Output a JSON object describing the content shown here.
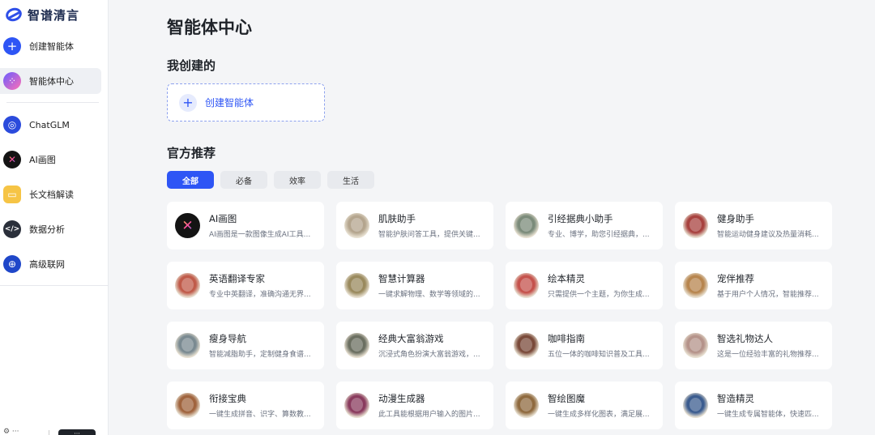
{
  "app": {
    "name": "智谱清言"
  },
  "sidebar": {
    "items": [
      {
        "label": "创建智能体",
        "icon": "plus-icon",
        "glyph": "+"
      },
      {
        "label": "智能体中心",
        "icon": "app-grid-icon",
        "glyph": "⁘"
      },
      {
        "label": "ChatGLM",
        "icon": "chatglm-logo-icon",
        "glyph": "◎"
      },
      {
        "label": "AI画图",
        "icon": "ai-draw-icon",
        "glyph": "✕"
      },
      {
        "label": "长文档解读",
        "icon": "folder-icon",
        "glyph": "▭"
      },
      {
        "label": "数据分析",
        "icon": "code-icon",
        "glyph": "</>"
      },
      {
        "label": "高级联网",
        "icon": "globe-icon",
        "glyph": "⊕"
      }
    ],
    "active_index": 1
  },
  "main": {
    "title": "智能体中心",
    "mine": {
      "heading": "我创建的",
      "create_label": "创建智能体"
    },
    "official": {
      "heading": "官方推荐",
      "tabs": [
        {
          "label": "全部",
          "active": true
        },
        {
          "label": "必备",
          "active": false
        },
        {
          "label": "效率",
          "active": false
        },
        {
          "label": "生活",
          "active": false
        }
      ],
      "cards": [
        {
          "title": "AI画图",
          "desc": "AI画图是一款图像生成AI工具...",
          "color": "#141414"
        },
        {
          "title": "肌肤助手",
          "desc": "智能护肤问答工具，提供关键...",
          "color": "#b4a58e"
        },
        {
          "title": "引经据典小助手",
          "desc": "专业、博学，助您引经据典，...",
          "color": "#7b8b7a"
        },
        {
          "title": "健身助手",
          "desc": "智能运动健身建议及热量消耗...",
          "color": "#a8423f"
        },
        {
          "title": "英语翻译专家",
          "desc": "专业中英翻译，准确沟通无界...",
          "color": "#c05b4a"
        },
        {
          "title": "智慧计算器",
          "desc": "一键求解物理、数学等领域的...",
          "color": "#9a8a5e"
        },
        {
          "title": "绘本精灵",
          "desc": "只需提供一个主题，为你生成...",
          "color": "#c5524c"
        },
        {
          "title": "宠伴推荐",
          "desc": "基于用户个人情况，智能推荐...",
          "color": "#b7854e"
        },
        {
          "title": "瘦身导航",
          "desc": "智能减脂助手，定制健身食谱...",
          "color": "#7a8a91"
        },
        {
          "title": "经典大富翁游戏",
          "desc": "沉浸式角色扮演大富翁游戏，...",
          "color": "#6b6f61"
        },
        {
          "title": "咖啡指南",
          "desc": "五位一体的咖啡知识普及工具...",
          "color": "#7a4a3a"
        },
        {
          "title": "智选礼物达人",
          "desc": "这是一位经验丰富的礼物推荐...",
          "color": "#b5938a"
        },
        {
          "title": "衔接宝典",
          "desc": "一键生成拼音、识字、算数教...",
          "color": "#a0643e"
        },
        {
          "title": "动漫生成器",
          "desc": "此工具能根据用户输入的图片...",
          "color": "#8a3b5e"
        },
        {
          "title": "智绘图魔",
          "desc": "一键生成多样化图表，满足展...",
          "color": "#8f6a3f"
        },
        {
          "title": "智造精灵",
          "desc": "一键生成专属智能体，快速匹...",
          "color": "#3b5c8f"
        }
      ]
    }
  },
  "colors": {
    "accent": "#2e55f5",
    "background": "#f4f5f7",
    "card": "#ffffff"
  }
}
